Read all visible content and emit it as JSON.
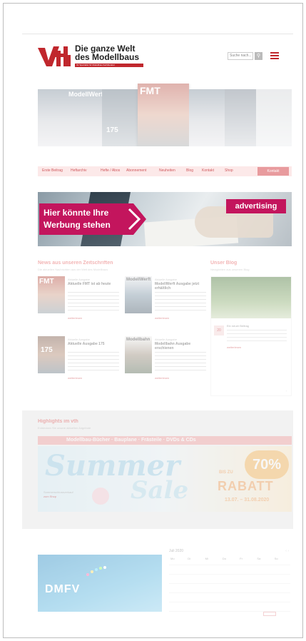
{
  "header": {
    "logo_line1": "Die ganze Welt",
    "logo_line2": "des Modellbaus",
    "logo_tagline": "Ihr Spezialist für Modellbau-Fachliteratur",
    "search_placeholder": "Suche nach...",
    "brand_color": "#c0272d"
  },
  "hero": {
    "main_magazine_title": "FMT",
    "side_magazine_title": "ModellWerft",
    "side_number": "175"
  },
  "nav": {
    "items": [
      "Erste Beitrag",
      "Heftarchiv",
      "Hefte / Abos",
      "Abonnement",
      "Neuheiten",
      "Blog",
      "Kontakt",
      "Shop"
    ],
    "button_label": "Kontakt"
  },
  "banner": {
    "text_line1": "Hier könnte Ihre",
    "text_line2": "Werbung stehen",
    "tag": "advertising",
    "accent_color": "#c3155d"
  },
  "news": {
    "title": "News aus unseren Zeitschriften",
    "subtitle": "Die aktuellen Nachrichten aus der Welt des Modellbaus",
    "cards": [
      {
        "meta": "Aktuelle Ausgabe",
        "title": "Aktuelle FMT ist ab heute",
        "cover": "FMT",
        "more": "weiterlesen"
      },
      {
        "meta": "Aktuelle Ausgabe",
        "title": "ModellWerft Ausgabe jetzt erhältlich",
        "cover": "ModellWerft",
        "more": "weiterlesen"
      },
      {
        "meta": "Aktuelle Ausgabe",
        "title": "Aktuelle Ausgabe 175",
        "cover": "175",
        "more": "weiterlesen"
      },
      {
        "meta": "Aktuelle Ausgabe",
        "title": "Modellbahn Ausgabe erschienen",
        "cover": "Modellbahn",
        "more": "weiterlesen"
      }
    ]
  },
  "blog": {
    "title": "Unser Blog",
    "subtitle": "Neuigkeiten aus unserem Blog",
    "date": "20",
    "post_title": "Ein neuer Beitrag",
    "more": "weiterlesen"
  },
  "highlights": {
    "title": "Highlights im vth",
    "subtitle": "Entdecken Sie unsere aktuellen Angebote",
    "bar_text": "Modellbau-Bücher · Bauplane · Frästeile · DVDs & CDs",
    "sale_word1": "Summer",
    "sale_word2": "Sale",
    "sale_percent": "70%",
    "sale_bis": "BIS ZU",
    "sale_rabatt": "RABATT",
    "sale_dates": "13.07. – 31.08.2020",
    "card_label": "Sommerschlussverkauf",
    "card_link": "zum Shop"
  },
  "footer": {
    "partner_logo": "DMFV",
    "calendar_title": "Juli 2020",
    "calendar_days": [
      "Mo",
      "Di",
      "Mi",
      "Do",
      "Fr",
      "Sa",
      "So"
    ]
  }
}
